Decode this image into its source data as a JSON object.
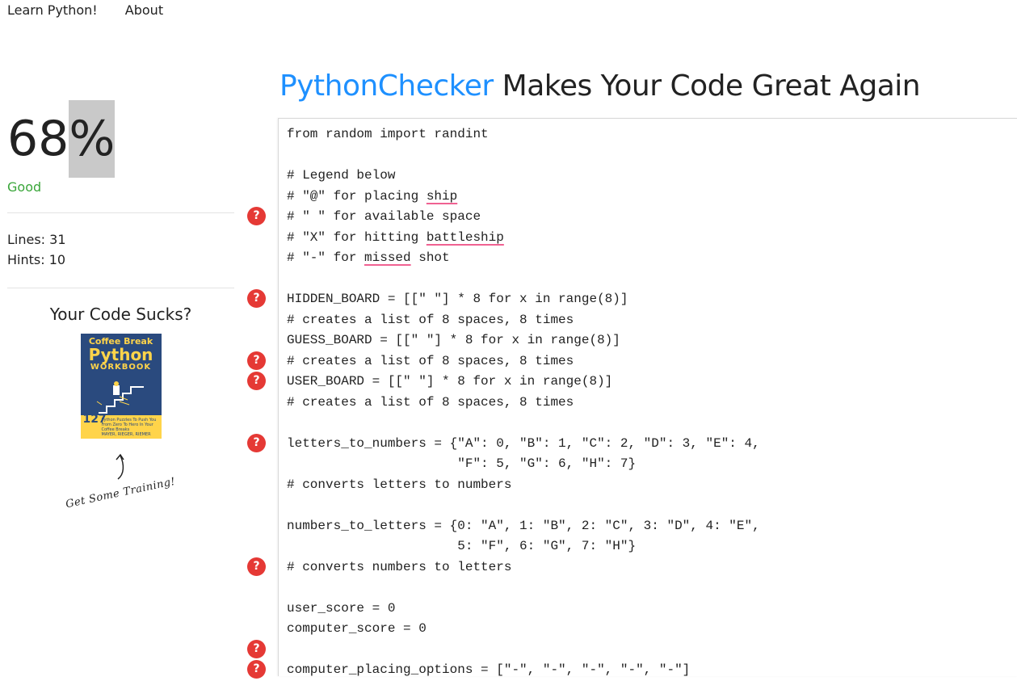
{
  "nav": {
    "items": [
      "Learn Python!",
      "About"
    ]
  },
  "title": {
    "brand": "PythonChecker",
    "rest": " Makes Your Code Great Again"
  },
  "score": {
    "value": "68",
    "unit": "%",
    "grade": "Good"
  },
  "stats": {
    "lines": "Lines: 31",
    "hints": "Hints: 10"
  },
  "promo": {
    "heading": "Your Code Sucks?",
    "book": {
      "line1": "Coffee Break",
      "line2": "Python",
      "line3": "WORKBOOK",
      "count": "127",
      "tagline": "Python Puzzles To Push You From Zero To Hero In Your Coffee Breaks",
      "author": "MAYER, RIEGER, RIEMER"
    },
    "cta": "Get Some Training!"
  },
  "code": {
    "lines": [
      "from random import randint",
      "",
      "# Legend below",
      "# \"@\" for placing ship",
      "# \" \" for available space",
      "# \"X\" for hitting battleship",
      "# \"-\" for missed shot",
      "",
      "HIDDEN_BOARD = [[\" \"] * 8 for x in range(8)]",
      "# creates a list of 8 spaces, 8 times",
      "GUESS_BOARD = [[\" \"] * 8 for x in range(8)]",
      "# creates a list of 8 spaces, 8 times",
      "USER_BOARD = [[\" \"] * 8 for x in range(8)]",
      "# creates a list of 8 spaces, 8 times",
      "",
      "letters_to_numbers = {\"A\": 0, \"B\": 1, \"C\": 2, \"D\": 3, \"E\": 4,",
      "                      \"F\": 5, \"G\": 6, \"H\": 7}",
      "# converts letters to numbers",
      "",
      "numbers_to_letters = {0: \"A\", 1: \"B\", 2: \"C\", 3: \"D\", 4: \"E\",",
      "                      5: \"F\", 6: \"G\", 7: \"H\"}",
      "# converts numbers to letters",
      "",
      "user_score = 0",
      "computer_score = 0",
      "",
      "computer_placing_options = [\"-\", \"-\", \"-\", \"-\", \"-\"]"
    ],
    "squiggles": [
      {
        "line": 3,
        "word": "ship"
      },
      {
        "line": 5,
        "word": "battleship"
      },
      {
        "line": 6,
        "word": "missed"
      }
    ]
  },
  "hints": {
    "label": "?",
    "lines": [
      4,
      8,
      11,
      12,
      15,
      21,
      25,
      26
    ]
  }
}
